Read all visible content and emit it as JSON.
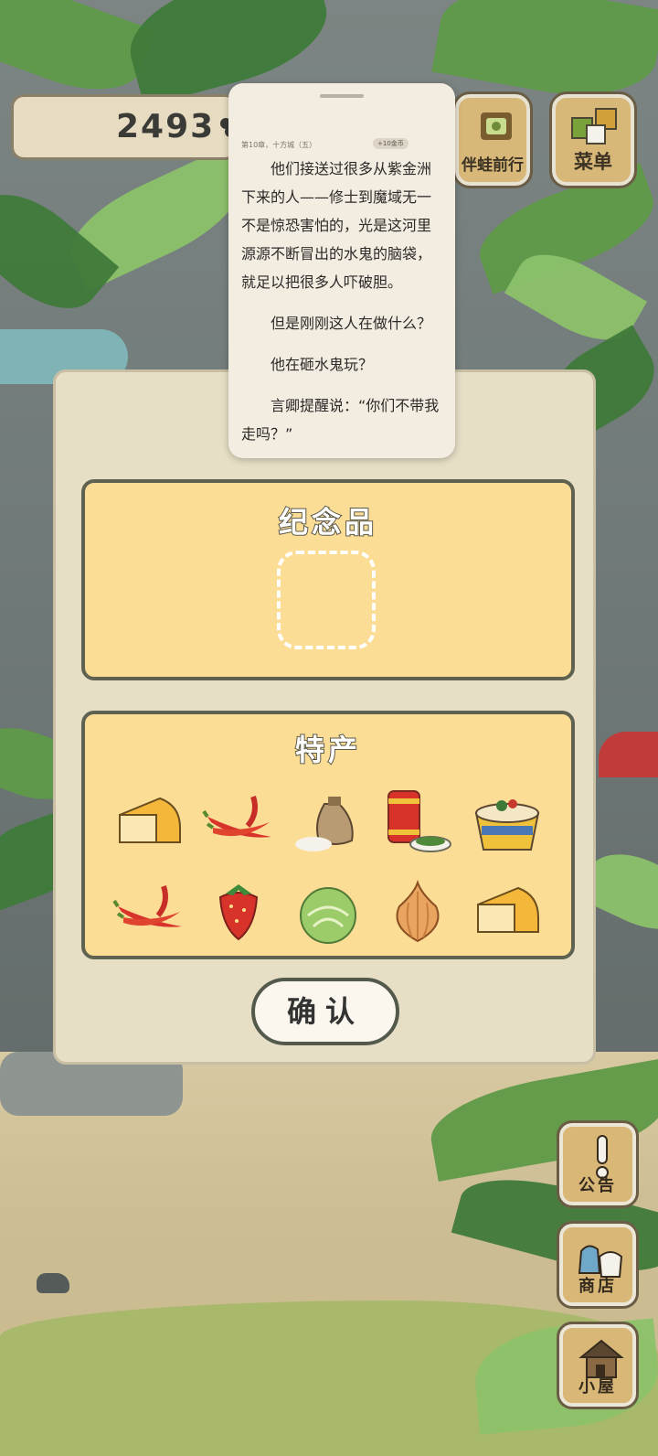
{
  "hud": {
    "clover_count": "2493",
    "travel_button": "伴蛙前行",
    "menu_button": "菜单"
  },
  "reader": {
    "nav_text": "第10章，十方城（五）",
    "coin_tag": "+10金币",
    "paragraphs": [
      "他们接送过很多从紫金洲下来的人——修士到魔域无一不是惊恐害怕的，光是这河里源源不断冒出的水鬼的脑袋，就足以把很多人吓破胆。",
      "但是刚刚这人在做什么？",
      "他在砸水鬼玩？",
      "言卿提醒说：“你们不带我走吗？”"
    ]
  },
  "souvenir_panel": {
    "souvenir_title": "纪念品",
    "specialty_title": "特产",
    "specialty_items": [
      {
        "name": "cheese-icon"
      },
      {
        "name": "red-pepper-icon"
      },
      {
        "name": "rice-sack-icon"
      },
      {
        "name": "tea-can-icon"
      },
      {
        "name": "noodle-bowl-icon"
      },
      {
        "name": "red-pepper-icon"
      },
      {
        "name": "strawberry-icon"
      },
      {
        "name": "cabbage-icon"
      },
      {
        "name": "onion-icon"
      },
      {
        "name": "cheese-icon"
      }
    ],
    "confirm_label": "确认"
  },
  "side_buttons": {
    "notice": "公告",
    "shop": "商店",
    "house": "小屋"
  }
}
